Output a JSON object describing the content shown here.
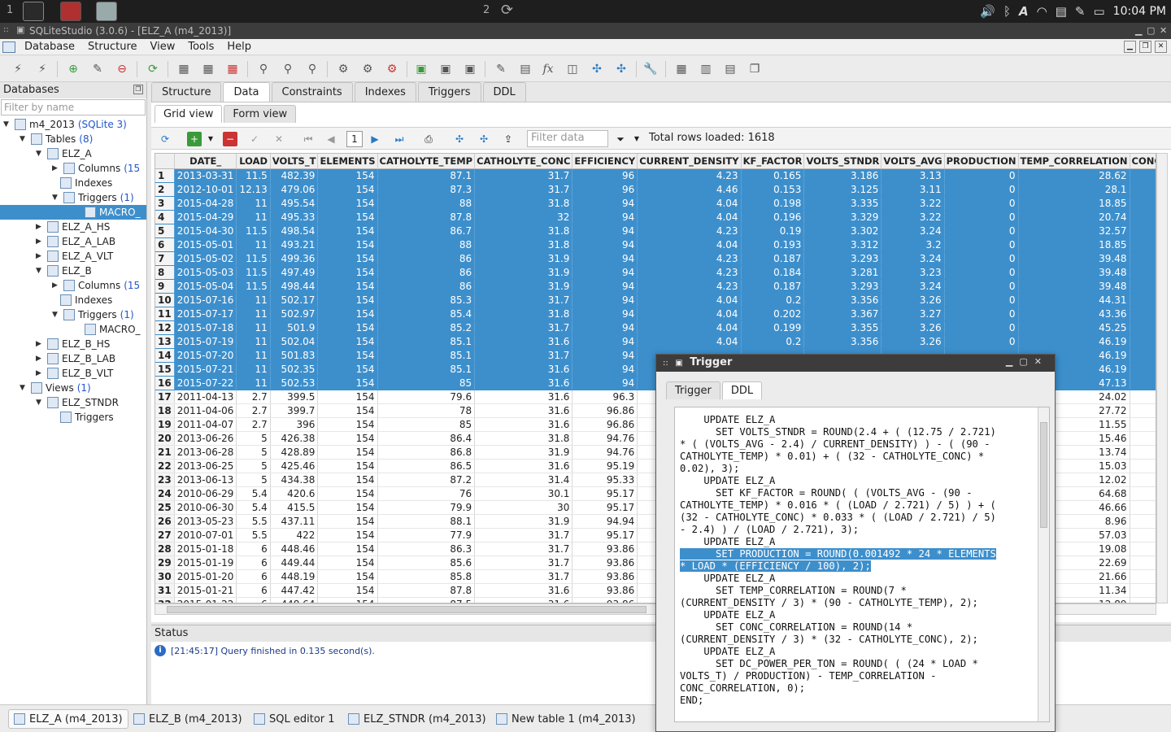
{
  "top_panel": {
    "workspace_1": "1",
    "workspace_2": "2",
    "clock": "10:04 PM",
    "tray_icons": [
      "volume-icon",
      "bluetooth-icon",
      "font-icon",
      "wifi-icon",
      "clipboard-icon",
      "pen-icon",
      "battery-icon"
    ]
  },
  "window": {
    "title": "SQLiteStudio (3.0.6) - [ELZ_A (m4_2013)]"
  },
  "menu": [
    "Database",
    "Structure",
    "View",
    "Tools",
    "Help"
  ],
  "left_panel": {
    "header": "Databases",
    "filter_placeholder": "Filter by name",
    "tree": {
      "db_name": "m4_2013",
      "db_type": "(SQLite 3)",
      "tables_label": "Tables",
      "tables_count": "(8)",
      "elz_a": "ELZ_A",
      "elz_a_columns": "Columns",
      "elz_a_columns_count": "(15",
      "elz_a_indexes": "Indexes",
      "elz_a_triggers": "Triggers",
      "elz_a_triggers_count": "(1)",
      "elz_a_trigger_macro": "MACRO_",
      "elz_a_hs": "ELZ_A_HS",
      "elz_a_lab": "ELZ_A_LAB",
      "elz_a_vlt": "ELZ_A_VLT",
      "elz_b": "ELZ_B",
      "elz_b_columns": "Columns",
      "elz_b_columns_count": "(15",
      "elz_b_indexes": "Indexes",
      "elz_b_triggers": "Triggers",
      "elz_b_triggers_count": "(1)",
      "elz_b_trigger_macro": "MACRO_",
      "elz_b_hs": "ELZ_B_HS",
      "elz_b_lab": "ELZ_B_LAB",
      "elz_b_vlt": "ELZ_B_VLT",
      "views_label": "Views",
      "views_count": "(1)",
      "elz_stndr": "ELZ_STNDR",
      "elz_stndr_triggers": "Triggers"
    }
  },
  "editor_tabs": [
    "Structure",
    "Data",
    "Constraints",
    "Indexes",
    "Triggers",
    "DDL"
  ],
  "data_subtabs": [
    "Grid view",
    "Form view"
  ],
  "gridbar": {
    "page": "1",
    "filter_placeholder": "Filter data",
    "total_rows": "Total rows loaded: 1618"
  },
  "columns": [
    "DATE_",
    "LOAD",
    "VOLTS_T",
    "ELEMENTS",
    "CATHOLYTE_TEMP",
    "CATHOLYTE_CONC",
    "EFFICIENCY",
    "CURRENT_DENSITY",
    "KF_FACTOR",
    "VOLTS_STNDR",
    "VOLTS_AVG",
    "PRODUCTION",
    "TEMP_CORRELATION",
    "CONC_"
  ],
  "rows": [
    [
      "1",
      "2013-03-31",
      "11.5",
      "482.39",
      "154",
      "87.1",
      "31.7",
      "96",
      "4.23",
      "0.165",
      "3.186",
      "3.13",
      "0",
      "28.62",
      ""
    ],
    [
      "2",
      "2012-10-01",
      "12.13",
      "479.06",
      "154",
      "87.3",
      "31.7",
      "96",
      "4.46",
      "0.153",
      "3.125",
      "3.11",
      "0",
      "28.1",
      ""
    ],
    [
      "3",
      "2015-04-28",
      "11",
      "495.54",
      "154",
      "88",
      "31.8",
      "94",
      "4.04",
      "0.198",
      "3.335",
      "3.22",
      "0",
      "18.85",
      ""
    ],
    [
      "4",
      "2015-04-29",
      "11",
      "495.33",
      "154",
      "87.8",
      "32",
      "94",
      "4.04",
      "0.196",
      "3.329",
      "3.22",
      "0",
      "20.74",
      ""
    ],
    [
      "5",
      "2015-04-30",
      "11.5",
      "498.54",
      "154",
      "86.7",
      "31.8",
      "94",
      "4.23",
      "0.19",
      "3.302",
      "3.24",
      "0",
      "32.57",
      ""
    ],
    [
      "6",
      "2015-05-01",
      "11",
      "493.21",
      "154",
      "88",
      "31.8",
      "94",
      "4.04",
      "0.193",
      "3.312",
      "3.2",
      "0",
      "18.85",
      ""
    ],
    [
      "7",
      "2015-05-02",
      "11.5",
      "499.36",
      "154",
      "86",
      "31.9",
      "94",
      "4.23",
      "0.187",
      "3.293",
      "3.24",
      "0",
      "39.48",
      ""
    ],
    [
      "8",
      "2015-05-03",
      "11.5",
      "497.49",
      "154",
      "86",
      "31.9",
      "94",
      "4.23",
      "0.184",
      "3.281",
      "3.23",
      "0",
      "39.48",
      ""
    ],
    [
      "9",
      "2015-05-04",
      "11.5",
      "498.44",
      "154",
      "86",
      "31.9",
      "94",
      "4.23",
      "0.187",
      "3.293",
      "3.24",
      "0",
      "39.48",
      ""
    ],
    [
      "10",
      "2015-07-16",
      "11",
      "502.17",
      "154",
      "85.3",
      "31.7",
      "94",
      "4.04",
      "0.2",
      "3.356",
      "3.26",
      "0",
      "44.31",
      ""
    ],
    [
      "11",
      "2015-07-17",
      "11",
      "502.97",
      "154",
      "85.4",
      "31.8",
      "94",
      "4.04",
      "0.202",
      "3.367",
      "3.27",
      "0",
      "43.36",
      ""
    ],
    [
      "12",
      "2015-07-18",
      "11",
      "501.9",
      "154",
      "85.2",
      "31.7",
      "94",
      "4.04",
      "0.199",
      "3.355",
      "3.26",
      "0",
      "45.25",
      ""
    ],
    [
      "13",
      "2015-07-19",
      "11",
      "502.04",
      "154",
      "85.1",
      "31.6",
      "94",
      "4.04",
      "0.2",
      "3.356",
      "3.26",
      "0",
      "46.19",
      ""
    ],
    [
      "14",
      "2015-07-20",
      "11",
      "501.83",
      "154",
      "85.1",
      "31.7",
      "94",
      "",
      "",
      "",
      "",
      "",
      "46.19",
      ""
    ],
    [
      "15",
      "2015-07-21",
      "11",
      "502.35",
      "154",
      "85.1",
      "31.6",
      "94",
      "",
      "",
      "",
      "",
      "",
      "46.19",
      ""
    ],
    [
      "16",
      "2015-07-22",
      "11",
      "502.53",
      "154",
      "85",
      "31.6",
      "94",
      "",
      "",
      "",
      "",
      "",
      "47.13",
      ""
    ],
    [
      "17",
      "2011-04-13",
      "2.7",
      "399.5",
      "154",
      "79.6",
      "31.6",
      "96.3",
      "",
      "",
      "",
      "",
      "",
      "24.02",
      ""
    ],
    [
      "18",
      "2011-04-06",
      "2.7",
      "399.7",
      "154",
      "78",
      "31.6",
      "96.86",
      "",
      "",
      "",
      "",
      "",
      "27.72",
      ""
    ],
    [
      "19",
      "2011-04-07",
      "2.7",
      "396",
      "154",
      "85",
      "31.6",
      "96.86",
      "",
      "",
      "",
      "",
      "",
      "11.55",
      ""
    ],
    [
      "20",
      "2013-06-26",
      "5",
      "426.38",
      "154",
      "86.4",
      "31.8",
      "94.76",
      "",
      "",
      "",
      "",
      "",
      "15.46",
      ""
    ],
    [
      "21",
      "2013-06-28",
      "5",
      "428.89",
      "154",
      "86.8",
      "31.9",
      "94.76",
      "",
      "",
      "",
      "",
      "",
      "13.74",
      ""
    ],
    [
      "22",
      "2013-06-25",
      "5",
      "425.46",
      "154",
      "86.5",
      "31.6",
      "95.19",
      "",
      "",
      "",
      "",
      "",
      "15.03",
      ""
    ],
    [
      "23",
      "2013-06-13",
      "5",
      "434.38",
      "154",
      "87.2",
      "31.4",
      "95.33",
      "",
      "",
      "",
      "",
      "",
      "12.02",
      ""
    ],
    [
      "24",
      "2010-06-29",
      "5.4",
      "420.6",
      "154",
      "76",
      "30.1",
      "95.17",
      "",
      "",
      "",
      "",
      "",
      "64.68",
      ""
    ],
    [
      "25",
      "2010-06-30",
      "5.4",
      "415.5",
      "154",
      "79.9",
      "30",
      "95.17",
      "",
      "",
      "",
      "",
      "",
      "46.66",
      ""
    ],
    [
      "26",
      "2013-05-23",
      "5.5",
      "437.11",
      "154",
      "88.1",
      "31.9",
      "94.94",
      "",
      "",
      "",
      "",
      "",
      "8.96",
      ""
    ],
    [
      "27",
      "2010-07-01",
      "5.5",
      "422",
      "154",
      "77.9",
      "31.7",
      "95.17",
      "",
      "",
      "",
      "",
      "",
      "57.03",
      ""
    ],
    [
      "28",
      "2015-01-18",
      "6",
      "448.46",
      "154",
      "86.3",
      "31.7",
      "93.86",
      "",
      "",
      "",
      "",
      "",
      "19.08",
      ""
    ],
    [
      "29",
      "2015-01-19",
      "6",
      "449.44",
      "154",
      "85.6",
      "31.7",
      "93.86",
      "",
      "",
      "",
      "",
      "",
      "22.69",
      ""
    ],
    [
      "30",
      "2015-01-20",
      "6",
      "448.19",
      "154",
      "85.8",
      "31.7",
      "93.86",
      "",
      "",
      "",
      "",
      "",
      "21.66",
      ""
    ],
    [
      "31",
      "2015-01-21",
      "6",
      "447.42",
      "154",
      "87.8",
      "31.6",
      "93.86",
      "",
      "",
      "",
      "",
      "",
      "11.34",
      ""
    ],
    [
      "32",
      "2015-01-22",
      "6",
      "448.64",
      "154",
      "87.5",
      "31.6",
      "93.86",
      "",
      "",
      "",
      "",
      "",
      "12.89",
      ""
    ]
  ],
  "status": {
    "header": "Status",
    "message": "[21:45:17]  Query finished in 0.135 second(s)."
  },
  "taskbar": [
    "ELZ_A (m4_2013)",
    "ELZ_B (m4_2013)",
    "SQL editor 1",
    "ELZ_STNDR (m4_2013)",
    "New table 1 (m4_2013)"
  ],
  "dialog": {
    "title": "Trigger",
    "tabs": [
      "Trigger",
      "DDL"
    ],
    "code_lines": [
      "    UPDATE ELZ_A",
      "      SET VOLTS_STNDR = ROUND(2.4 + ( (12.75 / 2.721)",
      "* ( (VOLTS_AVG - 2.4) / CURRENT_DENSITY) ) - ( (90 -",
      "CATHOLYTE_TEMP) * 0.01) + ( (32 - CATHOLYTE_CONC) *",
      "0.02), 3);",
      "    UPDATE ELZ_A",
      "      SET KF_FACTOR = ROUND( ( (VOLTS_AVG - (90 -",
      "CATHOLYTE_TEMP) * 0.016 * ( (LOAD / 2.721) / 5) ) + (",
      "(32 - CATHOLYTE_CONC) * 0.033 * ( (LOAD / 2.721) / 5)",
      "- 2.4) ) / (LOAD / 2.721), 3);",
      "    UPDATE ELZ_A",
      "      SET PRODUCTION = ROUND(0.001492 * 24 * ELEMENTS",
      "* LOAD * (EFFICIENCY / 100), 2);",
      "    UPDATE ELZ_A",
      "      SET TEMP_CORRELATION = ROUND(7 *",
      "(CURRENT_DENSITY / 3) * (90 - CATHOLYTE_TEMP), 2);",
      "    UPDATE ELZ_A",
      "      SET CONC_CORRELATION = ROUND(14 *",
      "(CURRENT_DENSITY / 3) * (32 - CATHOLYTE_CONC), 2);",
      "    UPDATE ELZ_A",
      "      SET DC_POWER_PER_TON = ROUND( ( (24 * LOAD *",
      "VOLTS_T) / PRODUCTION) - TEMP_CORRELATION -",
      "CONC_CORRELATION, 0);",
      "END;"
    ],
    "highlighted_lines": [
      11,
      12
    ]
  },
  "colors": {
    "selection": "#3d8fcc",
    "title_bar": "#3c3c3c",
    "count_blue": "#2255cc"
  }
}
